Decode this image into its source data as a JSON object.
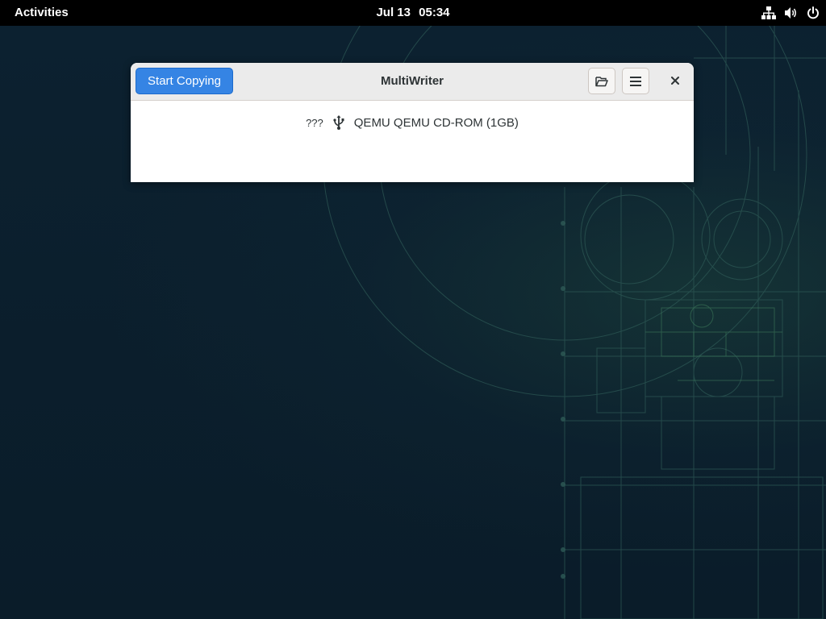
{
  "topbar": {
    "activities_label": "Activities",
    "clock_date": "Jul 13",
    "clock_time": "05:34",
    "tray_icons": [
      "network-wired-icon",
      "volume-icon",
      "power-icon"
    ]
  },
  "window": {
    "title": "MultiWriter",
    "start_label": "Start Copying",
    "header_icons": [
      "folder-open-icon",
      "hamburger-menu-icon",
      "close-icon"
    ],
    "devices": [
      {
        "status": "???",
        "icon": "usb-icon",
        "label": "QEMU QEMU CD-ROM (1GB)"
      }
    ]
  },
  "colors": {
    "accent": "#3584e4",
    "topbar": "#000000",
    "desktop": "#0b1d2b"
  }
}
